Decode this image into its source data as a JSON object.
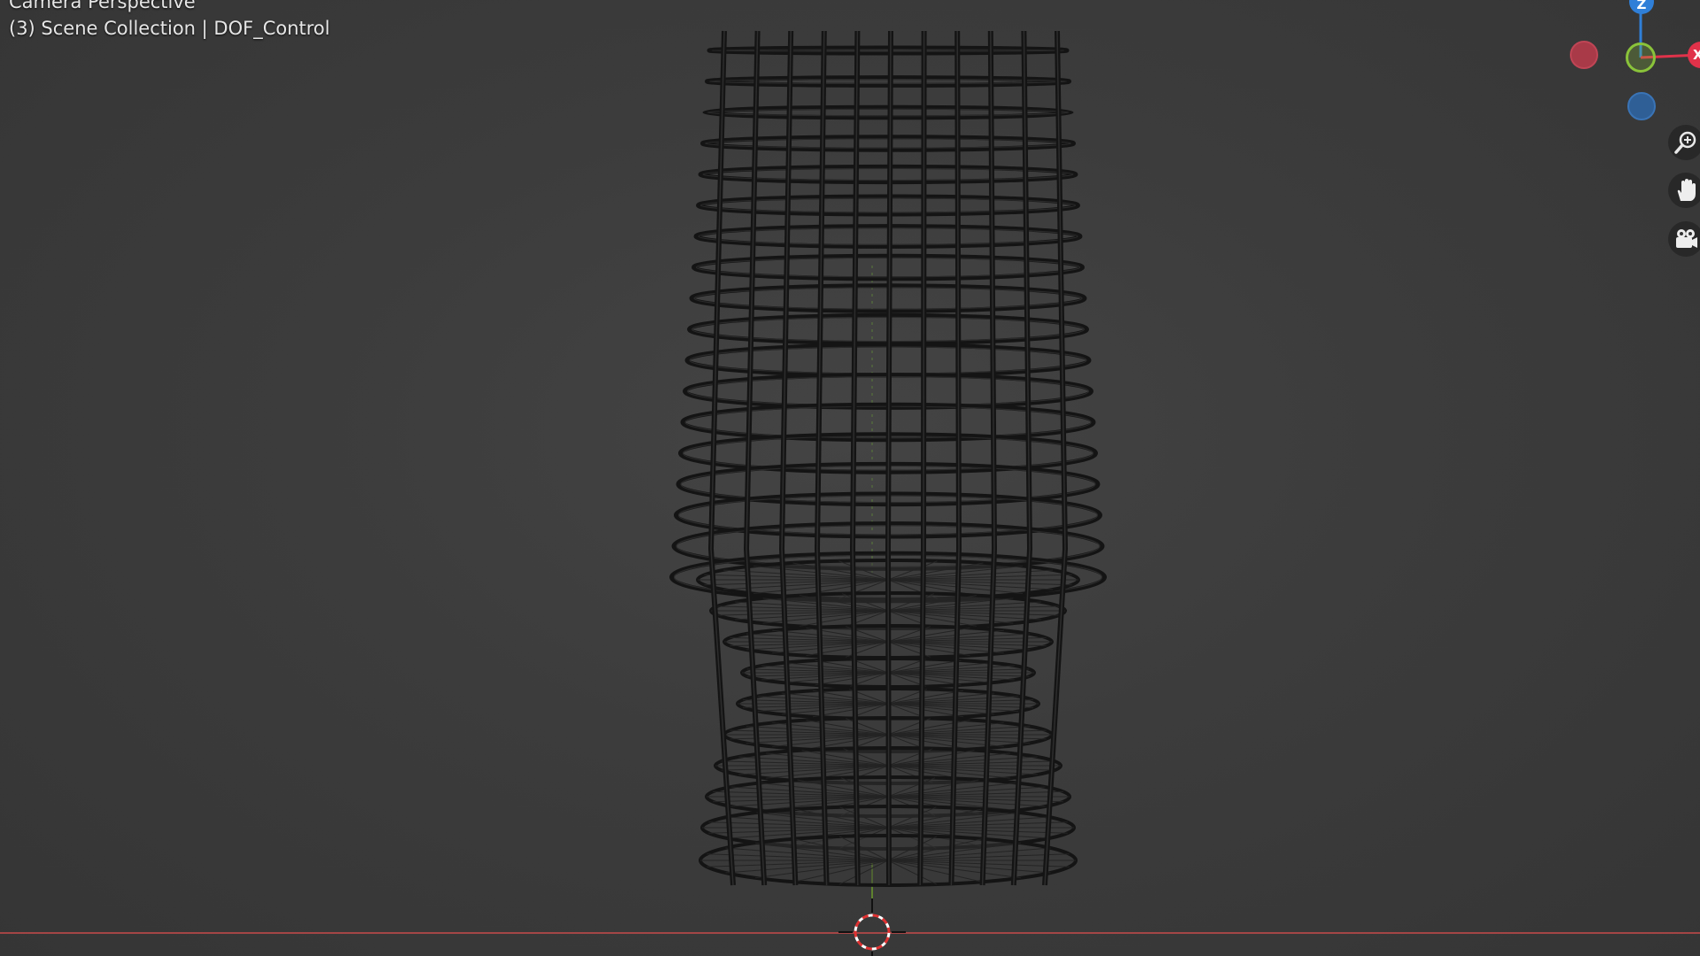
{
  "viewport": {
    "view_name": "Camera Perspective",
    "collection_label": "(3) Scene Collection | DOF_Control"
  },
  "gizmo": {
    "axes": [
      {
        "name": "z",
        "label": "Z",
        "color": "#2f7fd8"
      },
      {
        "name": "x",
        "label": "X",
        "color": "#e0324a"
      },
      {
        "name": "y",
        "label": "",
        "color": "#8ac33a"
      },
      {
        "name": "-x",
        "label": "",
        "color": "#b93a4a"
      },
      {
        "name": "-z",
        "label": "",
        "color": "#2f5f96"
      }
    ]
  },
  "navigation": {
    "buttons": [
      {
        "name": "zoom-button",
        "icon": "zoom-icon"
      },
      {
        "name": "pan-button",
        "icon": "hand-icon"
      },
      {
        "name": "camera-view-button",
        "icon": "camera-icon"
      }
    ]
  },
  "colors": {
    "background": "#3c3c3c",
    "wire": "#141414",
    "x_axis_line": "#c84a4a",
    "y_axis_line": "#6a9a2a"
  }
}
